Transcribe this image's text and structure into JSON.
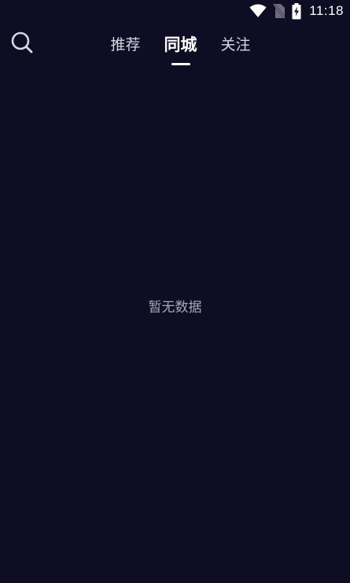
{
  "status_bar": {
    "time": "11:18",
    "icons": [
      "wifi-icon",
      "no-sim-icon",
      "battery-charging-icon"
    ]
  },
  "top_nav": {
    "search_icon": "search-icon",
    "tabs": [
      {
        "label": "推荐",
        "active": false
      },
      {
        "label": "同城",
        "active": true
      },
      {
        "label": "关注",
        "active": false
      }
    ]
  },
  "content": {
    "empty_text": "暂无数据"
  },
  "colors": {
    "background": "#0f0d23",
    "text_primary": "#ffffff",
    "text_secondary": "#a9a7b5"
  }
}
